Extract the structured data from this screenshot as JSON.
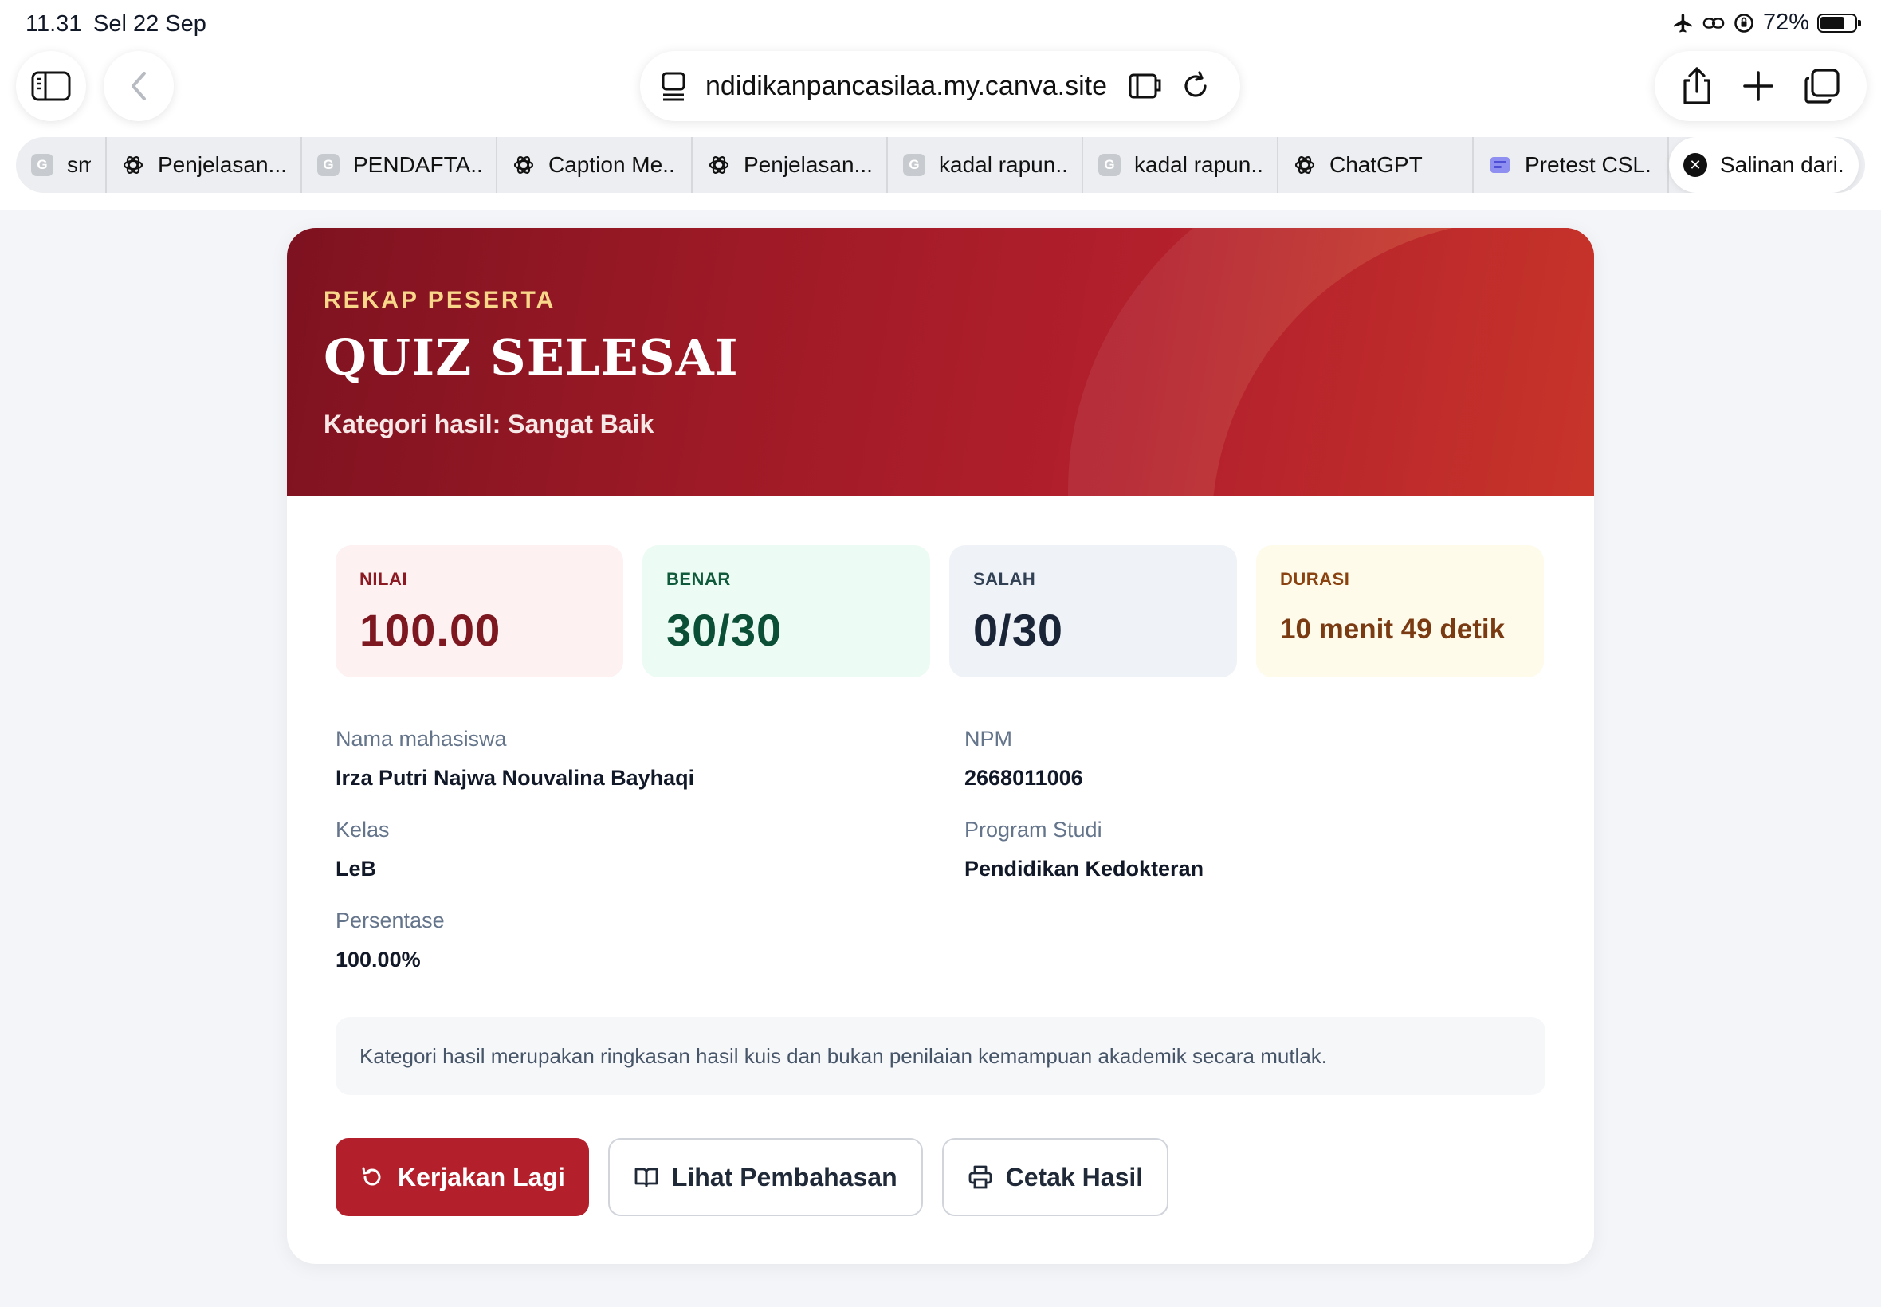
{
  "status_bar": {
    "time": "11.31",
    "date": "Sel 22 Sep",
    "battery": "72%"
  },
  "browser": {
    "url": "ndidikanpancasilaa.my.canva.site",
    "tabs": [
      {
        "icon": "google-icon",
        "title": "sma",
        "active": false
      },
      {
        "icon": "chatgpt-icon",
        "title": "Penjelasan...",
        "active": false
      },
      {
        "icon": "google-icon",
        "title": "PENDAFTA...",
        "active": false
      },
      {
        "icon": "chatgpt-icon",
        "title": "Caption Me...",
        "active": false
      },
      {
        "icon": "chatgpt-icon",
        "title": "Penjelasan...",
        "active": false
      },
      {
        "icon": "google-icon",
        "title": "kadal rapun...",
        "active": false
      },
      {
        "icon": "google-icon",
        "title": "kadal rapun...",
        "active": false
      },
      {
        "icon": "chatgpt-icon",
        "title": "ChatGPT",
        "active": false
      },
      {
        "icon": "app-icon",
        "title": "Pretest CSL...",
        "active": false
      },
      {
        "icon": "close-icon",
        "title": "Salinan dari...",
        "active": true
      }
    ]
  },
  "hero": {
    "eyebrow": "REKAP PESERTA",
    "title": "QUIZ SELESAI",
    "subtitle": "Kategori hasil: Sangat Baik"
  },
  "stats": {
    "nilai": {
      "label": "NILAI",
      "value": "100.00"
    },
    "benar": {
      "label": "BENAR",
      "value": "30/30"
    },
    "salah": {
      "label": "SALAH",
      "value": "0/30"
    },
    "durasi": {
      "label": "DURASI",
      "value": "10 menit 49 detik"
    }
  },
  "info": {
    "nama_label": "Nama mahasiswa",
    "nama": "Irza Putri Najwa Nouvalina Bayhaqi",
    "npm_label": "NPM",
    "npm": "2668011006",
    "kelas_label": "Kelas",
    "kelas": "LeB",
    "prodi_label": "Program Studi",
    "prodi": "Pendidikan Kedokteran",
    "persentase_label": "Persentase",
    "persentase": "100.00%"
  },
  "note": "Kategori hasil merupakan ringkasan hasil kuis dan bukan penilaian kemampuan akademik secara mutlak.",
  "actions": {
    "retry": "Kerjakan Lagi",
    "review": "Lihat Pembahasan",
    "print": "Cetak Hasil"
  },
  "colors": {
    "accent": "#b3202c",
    "hero_start": "#7e1220",
    "hero_end": "#d24a2a"
  }
}
